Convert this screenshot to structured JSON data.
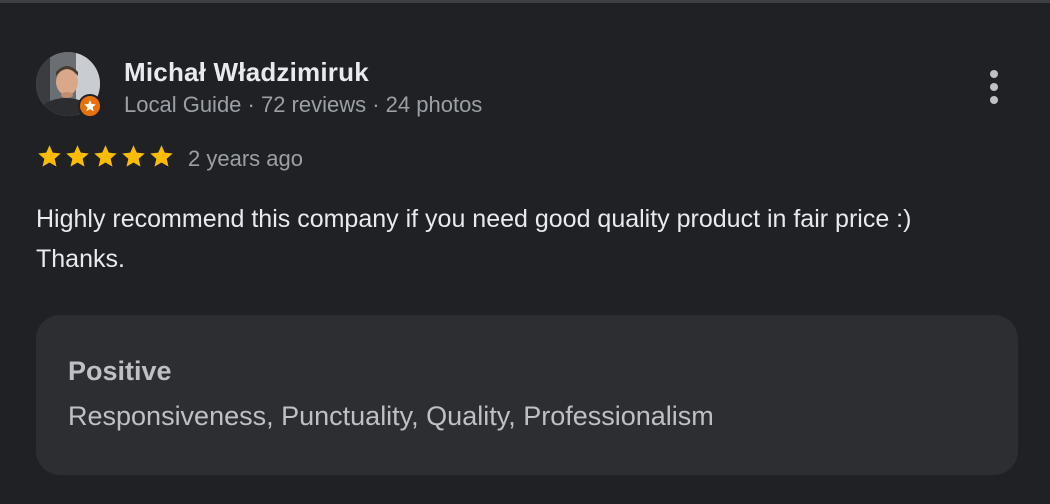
{
  "review": {
    "author": {
      "name": "Michał Władzimiruk",
      "meta": "Local Guide · 72 reviews · 24 photos",
      "badge_icon": "local-guide-star-icon"
    },
    "rating": {
      "stars": 5,
      "max": 5,
      "color": "#fbbc04"
    },
    "time": "2 years ago",
    "text_lines": [
      "Highly recommend this company if you need good quality product in fair price :)",
      "Thanks."
    ],
    "attributes": {
      "heading": "Positive",
      "values": "Responsiveness, Punctuality, Quality, Professionalism"
    },
    "more_icon": "more-vert-icon"
  },
  "colors": {
    "background": "#202124",
    "panel": "#2d2e31",
    "primary_text": "#e8eaed",
    "secondary_text": "#9aa0a6",
    "badge": "#e8710a"
  }
}
